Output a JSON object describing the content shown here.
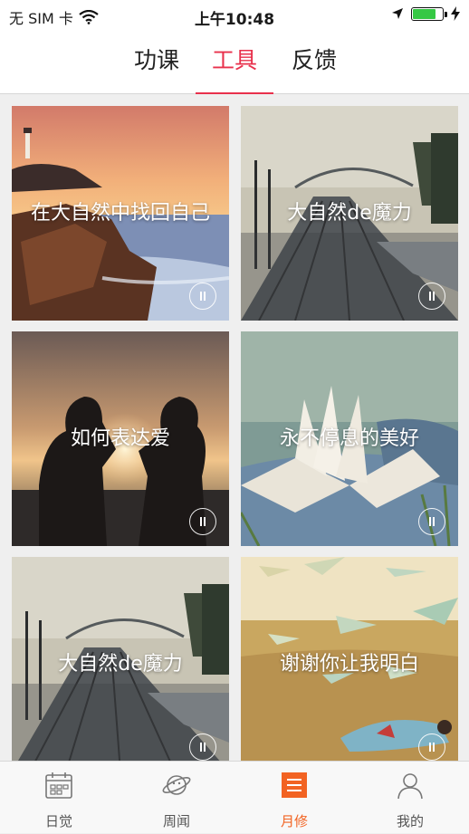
{
  "status_bar": {
    "carrier": "无 SIM 卡",
    "time": "上午10:48",
    "icons": [
      "wifi-icon",
      "location-arrow-icon",
      "battery-icon",
      "charging-bolt-icon"
    ],
    "battery_level": 0.8
  },
  "top_tabs": [
    {
      "label": "功课",
      "active": false
    },
    {
      "label": "工具",
      "active": true
    },
    {
      "label": "反馈",
      "active": false
    }
  ],
  "cards": [
    {
      "title": "在大自然中找回自己",
      "scene": "lighthouse-sunset",
      "icon": "pause-icon"
    },
    {
      "title": "大自然de魔力",
      "scene": "railway-bridge",
      "icon": "pause-icon"
    },
    {
      "title": "如何表达爱",
      "scene": "couple-heart-sunset",
      "icon": "pause-icon"
    },
    {
      "title": "永不停息的美好",
      "scene": "open-book-meadow",
      "icon": "pause-icon"
    },
    {
      "title": "大自然de魔力",
      "scene": "railway-bridge",
      "icon": "pause-icon"
    },
    {
      "title": "谢谢你让我明白",
      "scene": "paper-planes-field",
      "icon": "pause-icon"
    }
  ],
  "bottom_tabs": [
    {
      "label": "日觉",
      "icon": "calendar-icon",
      "active": false
    },
    {
      "label": "周闻",
      "icon": "planet-icon",
      "active": false
    },
    {
      "label": "月修",
      "icon": "list-icon",
      "active": true
    },
    {
      "label": "我的",
      "icon": "person-icon",
      "active": false
    }
  ],
  "colors": {
    "accent_tab": "#e8314c",
    "accent_bottom": "#f26322",
    "battery": "#35c844"
  }
}
